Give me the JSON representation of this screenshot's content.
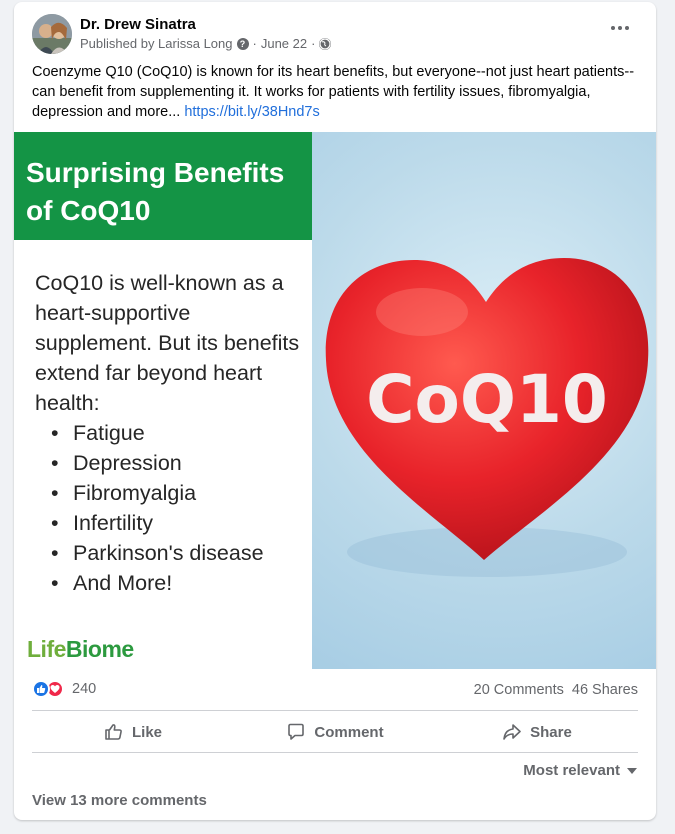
{
  "post": {
    "author": "Dr. Drew Sinatra",
    "published_by": "Published by Larissa Long",
    "date": "June 22",
    "text": "Coenzyme Q10 (CoQ10) is known for its heart benefits, but everyone--not just heart patients--can benefit from supplementing it. It works for patients with fertility issues, fibromyalgia, depression and more... ",
    "link": "https://bit.ly/38Hnd7s"
  },
  "image": {
    "banner_title": "Surprising Benefits of CoQ10",
    "body_text": "CoQ10 is well-known as a heart-supportive supplement. But its benefits extend far beyond heart health:",
    "bullets": [
      "Fatigue",
      "Depression",
      "Fibromyalgia",
      "Infertility",
      "Parkinson's disease",
      "And More!"
    ],
    "logo_part1": "Life",
    "logo_part2": "Biome",
    "heart_text": "CoQ10"
  },
  "stats": {
    "reaction_count": "240",
    "comments": "20 Comments",
    "shares": "46 Shares"
  },
  "actions": {
    "like": "Like",
    "comment": "Comment",
    "share": "Share"
  },
  "comments": {
    "sort_label": "Most relevant",
    "view_more": "View 13 more comments"
  },
  "colors": {
    "banner_green": "#149445",
    "heart_red": "#e8232a",
    "link_blue": "#216fdb",
    "like_blue": "#1b74e4",
    "love_red": "#f0284a"
  }
}
